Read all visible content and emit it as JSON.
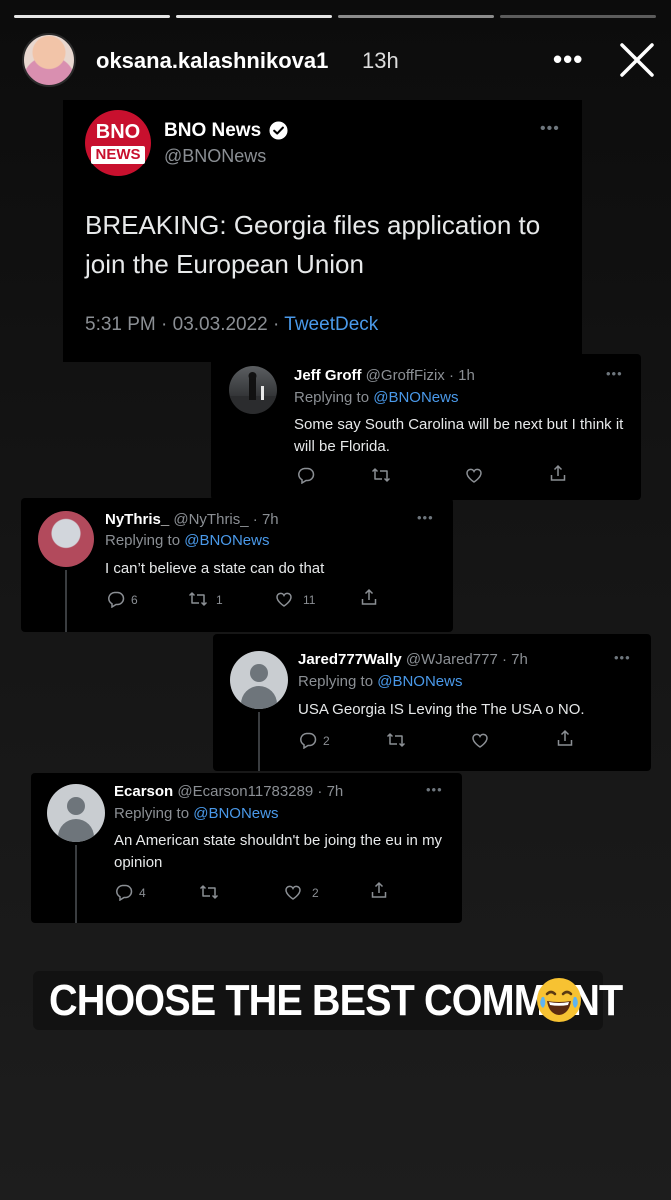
{
  "story": {
    "progress_count": 4,
    "username": "oksana.kalashnikova1",
    "time": "13h",
    "menu_dots": "•••",
    "caption": "CHOOSE THE BEST COMMENT"
  },
  "main_tweet": {
    "logo_line1": "BNO",
    "logo_line2": "NEWS",
    "name": "BNO News",
    "handle": "@BNONews",
    "more": "•••",
    "text": "BREAKING: Georgia files application to join the European Union",
    "meta": "5:31 PM · 03.03.2022 · ",
    "source": "TweetDeck"
  },
  "replies": [
    {
      "name": "Jeff Groff",
      "handle": "@GroffFizix · 1h",
      "replying_prefix": "Replying to ",
      "mention": "@BNONews",
      "text": "Some say South Carolina will be next but I think it will be Florida.",
      "reply_count": "",
      "retweet_count": "",
      "like_count": ""
    },
    {
      "name": "NyThris_",
      "handle": "@NyThris_ · 7h",
      "replying_prefix": "Replying to ",
      "mention": "@BNONews",
      "text": "I can’t believe a state can do that",
      "reply_count": "6",
      "retweet_count": "1",
      "like_count": "11"
    },
    {
      "name": "Jared777Wally",
      "handle": "@WJared777 · 7h",
      "replying_prefix": "Replying to ",
      "mention": "@BNONews",
      "text": "USA Georgia IS Leving the The USA o NO.",
      "reply_count": "2",
      "retweet_count": "",
      "like_count": ""
    },
    {
      "name": "Ecarson",
      "handle": "@Ecarson11783289 · 7h",
      "replying_prefix": "Replying to ",
      "mention": "@BNONews",
      "text": "An American state shouldn't be joing the eu in my opinion",
      "reply_count": "4",
      "retweet_count": "",
      "like_count": "2"
    }
  ],
  "colors": {
    "link": "#4a99e9",
    "muted": "#8b8f94",
    "bno_red": "#c8102e",
    "verified": "#ffffff"
  },
  "icons": [
    "close-icon",
    "more-icon",
    "verified-badge-icon",
    "reply-icon",
    "retweet-icon",
    "like-icon",
    "share-icon",
    "laughing-emoji-icon"
  ]
}
